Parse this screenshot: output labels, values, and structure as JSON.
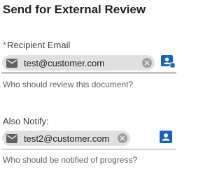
{
  "dialog": {
    "title": "Send for External Review"
  },
  "recipient": {
    "required_marker": "*",
    "label": "Recipient Email",
    "chip_value": "test@customer.com",
    "helper": "Who should review this document?"
  },
  "notify": {
    "label": "Also Notify:",
    "chip_value": "test2@customer.com",
    "helper": "Who should be notified of progress?"
  },
  "colors": {
    "accent": "#1565c0",
    "required": "#e53935",
    "chip_bg": "#e0e0e0"
  },
  "icons": {
    "chip_icon": "mail-icon",
    "remove_icon": "close-circle-icon",
    "picker_icon": "contact-card-icon"
  }
}
